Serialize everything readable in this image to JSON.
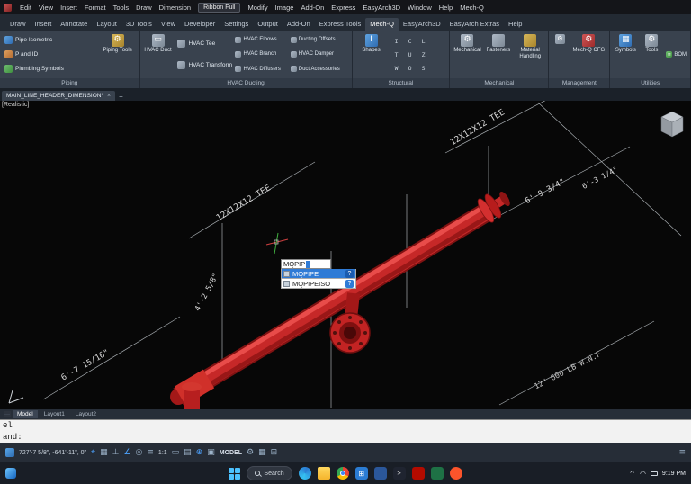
{
  "colors": {
    "pipe_red": "#c62828",
    "accent_blue": "#2f7bd6",
    "ribbon_bg": "#39424e"
  },
  "menubar": {
    "items": [
      "Edit",
      "View",
      "Insert",
      "Format",
      "Tools",
      "Draw",
      "Dimension",
      "Modify",
      "Image",
      "Add-On",
      "Express",
      "EasyArch3D",
      "Window",
      "Help",
      "Mech-Q"
    ],
    "workspace": "Ribbon Full"
  },
  "ribbon_tabs": {
    "items": [
      "Draw",
      "Insert",
      "Annotate",
      "Layout",
      "3D Tools",
      "View",
      "Developer",
      "Settings",
      "Output",
      "Add-On",
      "Express Tools",
      "Mech-Q",
      "EasyArch3D",
      "EasyArch Extras",
      "Help"
    ]
  },
  "ribbon": {
    "piping": {
      "label": "Piping",
      "pipe_isometric": "Pipe Isometric",
      "p_and_id": "P and ID",
      "plumbing_symbols": "Plumbing Symbols",
      "piping_tools": "Piping Tools"
    },
    "hvac": {
      "label": "HVAC Ducting",
      "duct": "HVAC Duct",
      "tee": "HVAC Tee",
      "transform": "HVAC Transform",
      "elbows": "HVAC Elbows",
      "branch": "HVAC Branch",
      "diffusers": "HVAC Diffusers",
      "offsets": "Ducting Offsets",
      "damper": "HVAC Damper",
      "accessories": "Duct Accessories"
    },
    "structural": {
      "label": "Structural",
      "shapes": "Shapes"
    },
    "mechanical": {
      "label": "Mechanical",
      "mechanical": "Mechanical",
      "fasteners": "Fasteners",
      "material_handling": "Material Handling"
    },
    "management": {
      "label": "Management",
      "cfg": "Mech-Q CFG"
    },
    "utilities": {
      "label": "Utilities",
      "symbols": "Symbols",
      "tools": "Tools",
      "bom": "BOM"
    }
  },
  "doc_tabs": {
    "active_tab": "MAIN_LINE_HEADER_DIMENSION*"
  },
  "viewport": {
    "view_style": "[Realistic]",
    "annotations": {
      "tee_left": "12X12X12 TEE",
      "tee_right": "12X12X12 TEE",
      "dim_a": "6'-9 3/4\"",
      "dim_b": "6'-3 1/4\"",
      "dim_c": "4'-2 5/8\"",
      "dim_d": "6'-7 15/16\"",
      "spec": "12\" 600 LB W.N.F"
    },
    "popup": {
      "typed": "MQPIP",
      "option_1": "MQPIPE",
      "option_2": "MQPIPEISO",
      "help": "?"
    }
  },
  "layout_tabs": {
    "model": "Model",
    "layout1": "Layout1",
    "layout2": "Layout2"
  },
  "command": {
    "line_1": "el",
    "line_2": "and:"
  },
  "statusbar": {
    "coordinates": "727'-7 5/8\", -641'-11\", 0\"",
    "scale": "1:1",
    "model_label": "MODEL"
  },
  "taskbar": {
    "search_placeholder": "Search",
    "time": "9:19 PM"
  }
}
